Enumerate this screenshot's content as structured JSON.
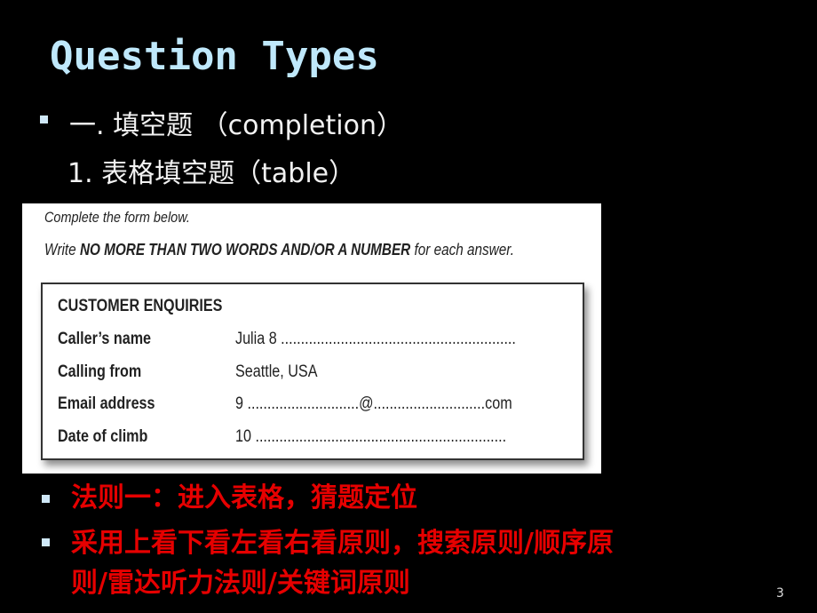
{
  "slide": {
    "title": "Question Types",
    "bullet1": "一. 填空题 （completion）",
    "sub1": "1. 表格填空题（table）",
    "page_number": "3",
    "colors": {
      "title": "#bfe8fb",
      "rule_text": "#e60000",
      "background": "#000000"
    }
  },
  "form": {
    "instruction1": "Complete the form below.",
    "instruction2_pre": "Write ",
    "instruction2_bold": "NO MORE THAN TWO WORDS AND/OR A NUMBER",
    "instruction2_post": " for each answer.",
    "heading": "CUSTOMER ENQUIRIES",
    "rows": [
      {
        "label": "Caller’s name",
        "value": "Julia 8 ..........................................................."
      },
      {
        "label": "Calling from",
        "value": "Seattle, USA"
      },
      {
        "label": "Email address",
        "value": "9 ............................@............................com"
      },
      {
        "label": "Date of climb",
        "value": "10 ..............................................................."
      }
    ]
  },
  "rules": {
    "rule1": "法则一：进入表格，猜题定位",
    "rule2_line1": "采用上看下看左看右看原则，搜索原则/顺序原",
    "rule2_line2": "则/雷达听力法则/关键词原则"
  }
}
